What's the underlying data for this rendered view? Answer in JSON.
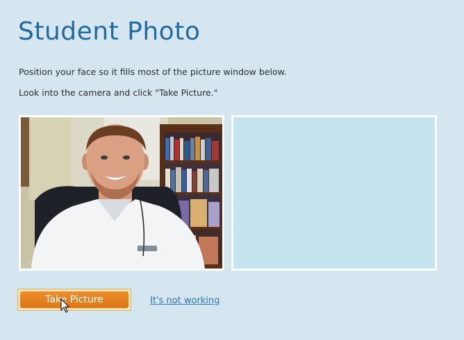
{
  "page": {
    "title": "Student Photo",
    "instructions": [
      "Position your face so it fills most of the picture window below.",
      "Look into the camera and click \"Take Picture.\""
    ]
  },
  "camera": {
    "live_feed_icon": "webcam-photo",
    "preview_color": "#c6e4ef"
  },
  "actions": {
    "take_picture_label": "Take Picture",
    "not_working_label": "It's not working"
  },
  "colors": {
    "background": "#d6e6f0",
    "title": "#1f6aa0",
    "button": "#e3811f",
    "link": "#2a73b8"
  }
}
